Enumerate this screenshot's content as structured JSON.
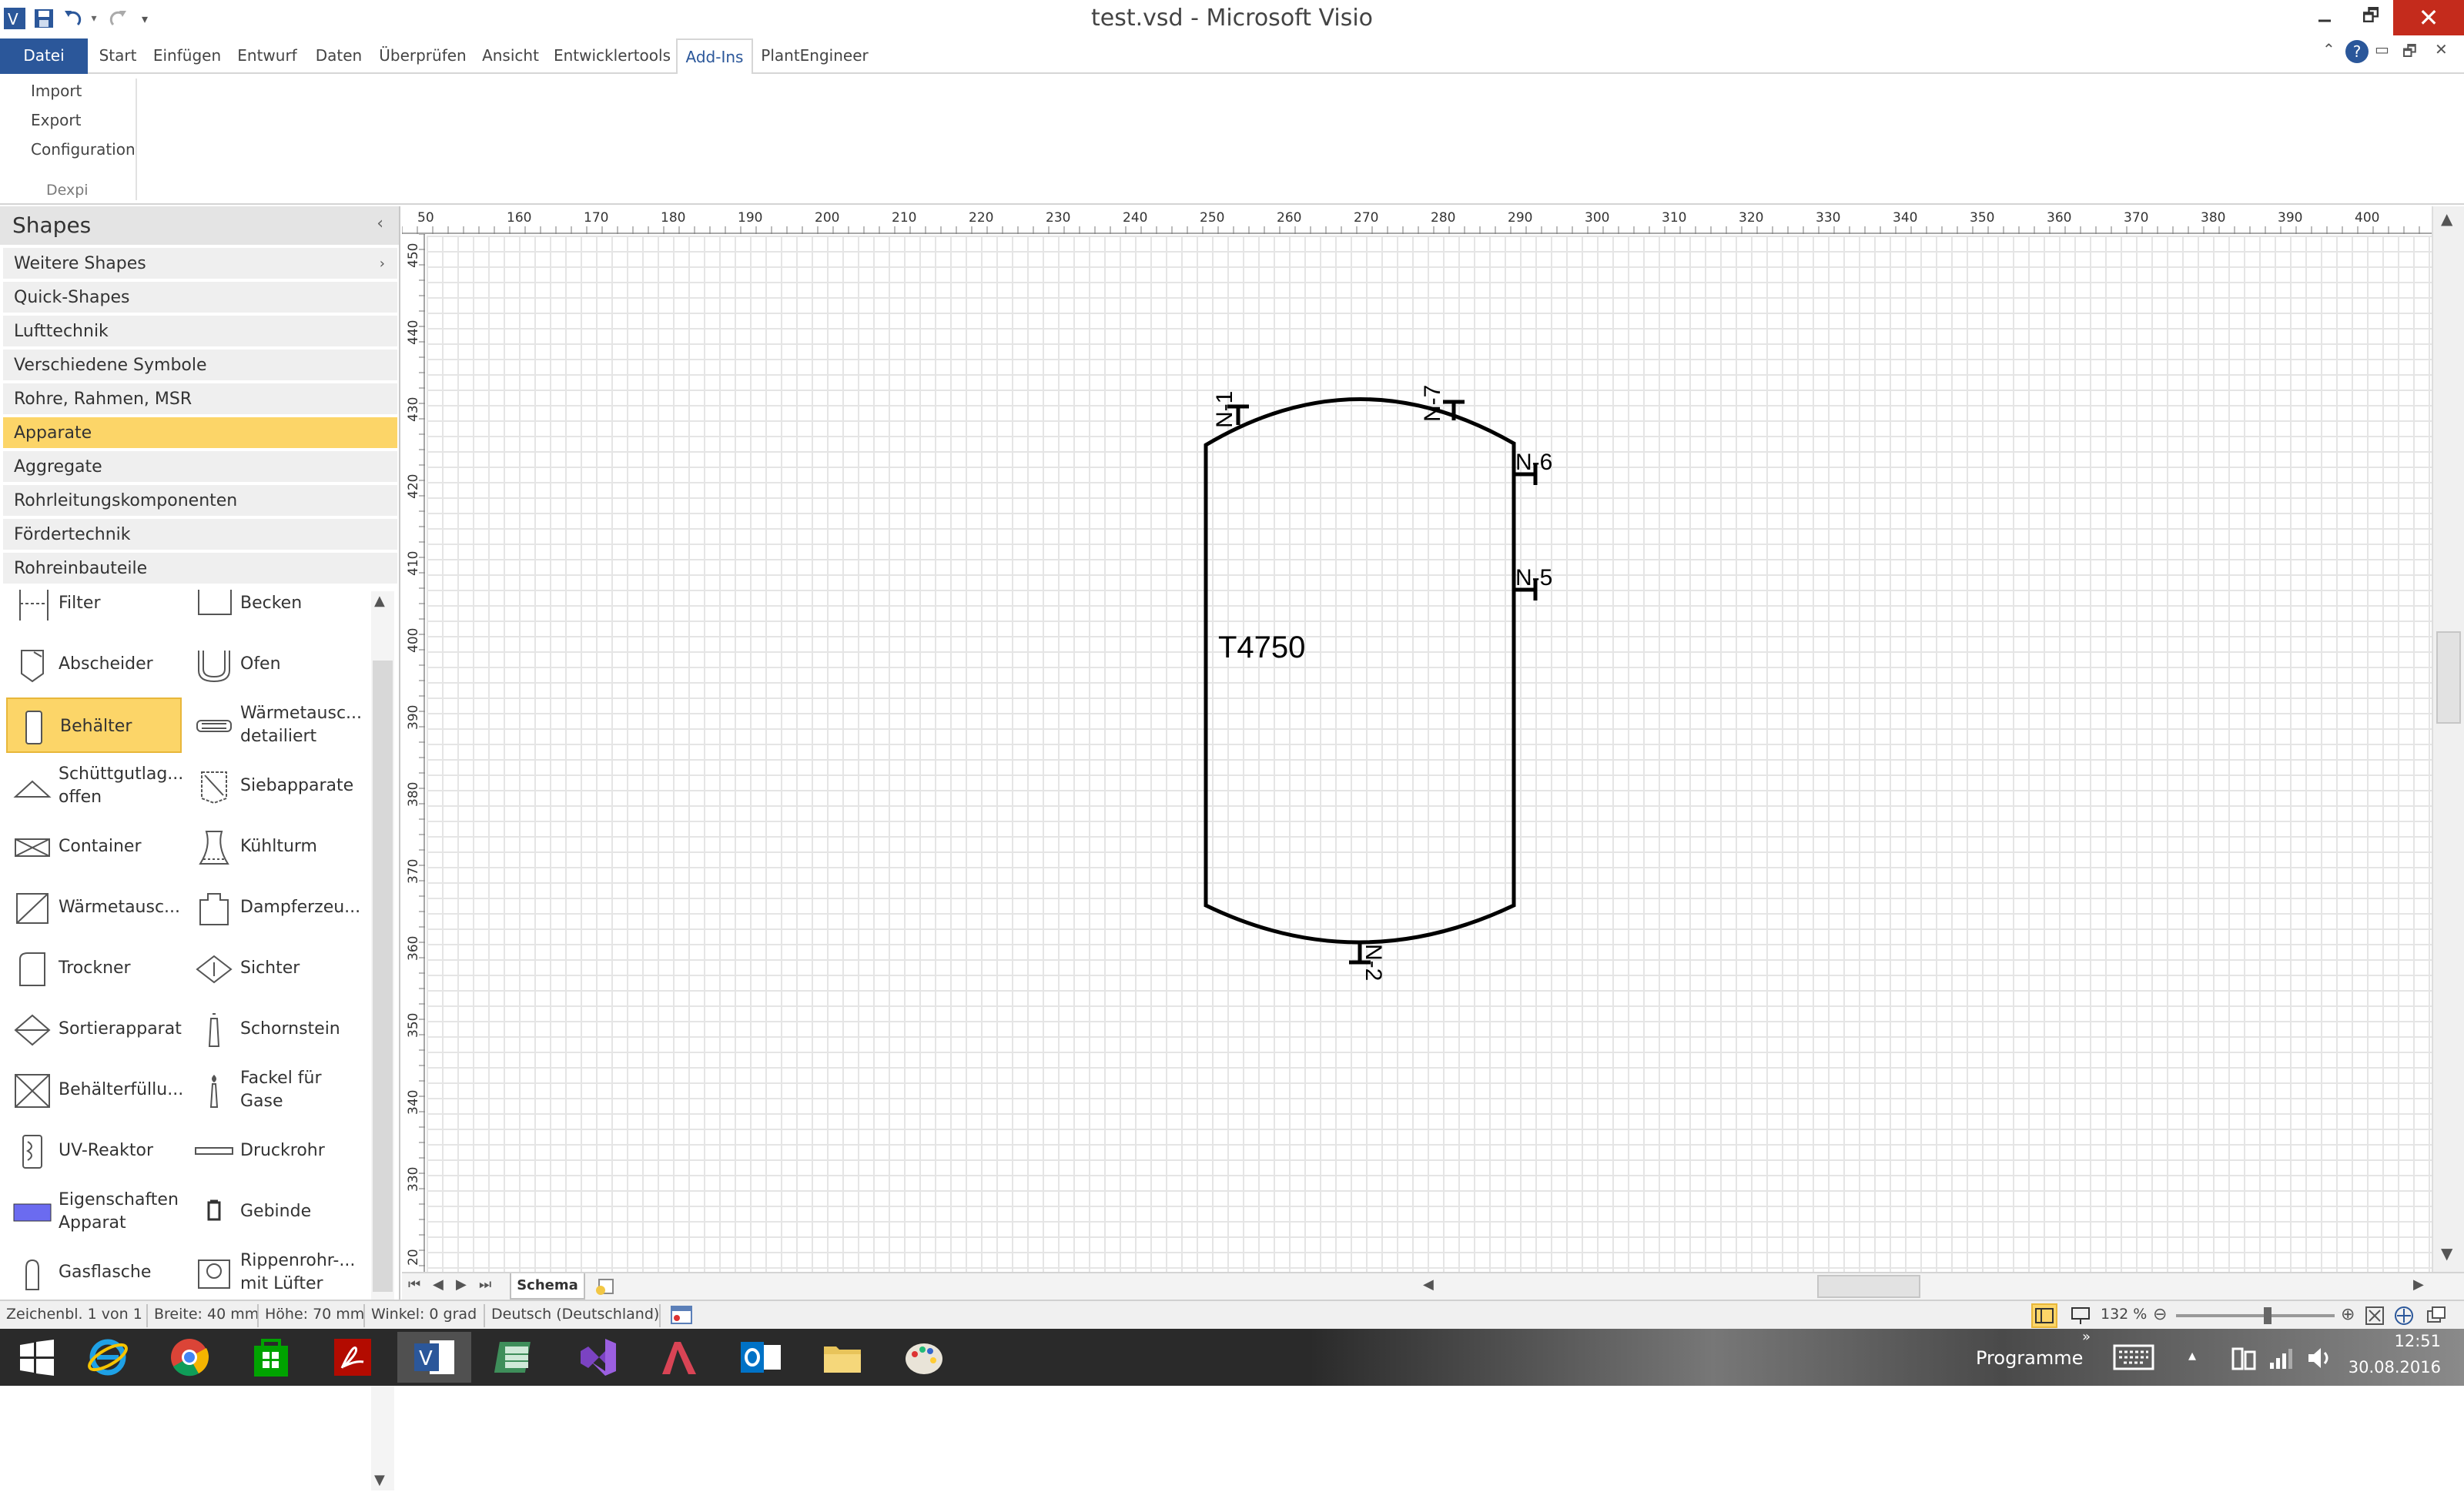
{
  "window": {
    "title": "test.vsd - Microsoft Visio",
    "restore_glyph": "🗗",
    "close_glyph": "✕",
    "qa_customize": "▾"
  },
  "ribbon_tabs": [
    "Datei",
    "Start",
    "Einfügen",
    "Entwurf",
    "Daten",
    "Überprüfen",
    "Ansicht",
    "Entwicklertools",
    "Add-Ins",
    "PlantEngineer"
  ],
  "ribbon_controls": {
    "collapse": "⌃",
    "help": "?",
    "restore": "🗗",
    "close": "✕"
  },
  "ribbon": {
    "buttons": [
      "Import",
      "Export",
      "Configuration"
    ],
    "group_label": "Dexpi"
  },
  "shapes_panel": {
    "title": "Shapes",
    "collapse_glyph": "‹",
    "more_glyph": "›",
    "stencils": [
      "Weitere Shapes",
      "Quick-Shapes",
      "Lufttechnik",
      "Verschiedene Symbole",
      "Rohre, Rahmen, MSR",
      "Apparate",
      "Aggregate",
      "Rohrleitungskomponenten",
      "Fördertechnik",
      "Rohreinbauteile"
    ],
    "selected_stencil": "Apparate",
    "masters": [
      {
        "label": "Filter",
        "icon": "filter-icon"
      },
      {
        "label": "Becken",
        "icon": "basin-icon"
      },
      {
        "label": "Abscheider",
        "icon": "separator-icon"
      },
      {
        "label": "Ofen",
        "icon": "furnace-icon"
      },
      {
        "label": "Behälter",
        "icon": "vessel-icon",
        "selected": true
      },
      {
        "label": "Wärmetausc...\ndetailiert",
        "icon": "heat-exchanger-detailed-icon"
      },
      {
        "label": "Schüttgutlag...\noffen",
        "icon": "bulk-storage-open-icon"
      },
      {
        "label": "Siebapparate",
        "icon": "sieve-icon"
      },
      {
        "label": "Container",
        "icon": "container-icon"
      },
      {
        "label": "Kühlturm",
        "icon": "cooling-tower-icon"
      },
      {
        "label": "Wärmetausc...",
        "icon": "heat-exchanger-icon"
      },
      {
        "label": "Dampferzeu...",
        "icon": "steam-generator-icon"
      },
      {
        "label": "Trockner",
        "icon": "dryer-icon"
      },
      {
        "label": "Sichter",
        "icon": "classifier-icon"
      },
      {
        "label": "Sortierapparat",
        "icon": "sorter-icon"
      },
      {
        "label": "Schornstein",
        "icon": "chimney-icon"
      },
      {
        "label": "Behälterfüllu...",
        "icon": "vessel-filling-icon"
      },
      {
        "label": "Fackel für\nGase",
        "icon": "gas-flare-icon"
      },
      {
        "label": "UV-Reaktor",
        "icon": "uv-reactor-icon"
      },
      {
        "label": "Druckrohr",
        "icon": "pressure-pipe-icon"
      },
      {
        "label": "Eigenschaften\nApparat",
        "icon": "properties-icon"
      },
      {
        "label": "Gebinde",
        "icon": "container-drum-icon"
      },
      {
        "label": "Gasflasche",
        "icon": "gas-cylinder-icon"
      },
      {
        "label": "Rippenrohr-...\nmit Lüfter",
        "icon": "finned-tube-fan-icon"
      }
    ]
  },
  "rulers": {
    "horizontal": [
      "50",
      "160",
      "170",
      "180",
      "190",
      "200",
      "210",
      "220",
      "230",
      "240",
      "250",
      "260",
      "270",
      "280",
      "290",
      "300",
      "310",
      "320",
      "330",
      "340",
      "350",
      "360",
      "370",
      "380",
      "390",
      "400",
      "4"
    ],
    "vertical": [
      "450",
      "440",
      "430",
      "420",
      "410",
      "400",
      "390",
      "380",
      "370",
      "360",
      "350",
      "340",
      "330",
      "20"
    ]
  },
  "drawing": {
    "vessel_label": "T4750",
    "nozzles": [
      "N-1",
      "N-7",
      "N-6",
      "N-5",
      "N-2"
    ],
    "stroke_color": "#000000"
  },
  "page_bar": {
    "nav": [
      "⏮",
      "◀",
      "▶",
      "⏭"
    ],
    "page_tab": "Schema"
  },
  "status_bar": {
    "page": "Zeichenbl. 1 von 1",
    "width": "Breite: 40 mm",
    "height": "Höhe: 70 mm",
    "angle": "Winkel: 0 grad",
    "language": "Deutsch (Deutschland)",
    "zoom": "132 %",
    "zoom_level": 0.58
  },
  "taskbar": {
    "apps": [
      "windows-start-icon",
      "internet-explorer-icon",
      "chrome-icon",
      "store-icon",
      "acrobat-icon",
      "visio-icon",
      "spreadsheet-icon",
      "visual-studio-icon",
      "app-icon",
      "outlook-icon",
      "file-explorer-icon",
      "paint-icon"
    ],
    "programs_label": "Programme",
    "programs_glyph": "»",
    "tray_up": "▴",
    "time": "12:51",
    "date": "30.08.2016"
  },
  "colors": {
    "accent": "#2b579a",
    "selected": "#fcd568",
    "close": "#c42b1c"
  }
}
